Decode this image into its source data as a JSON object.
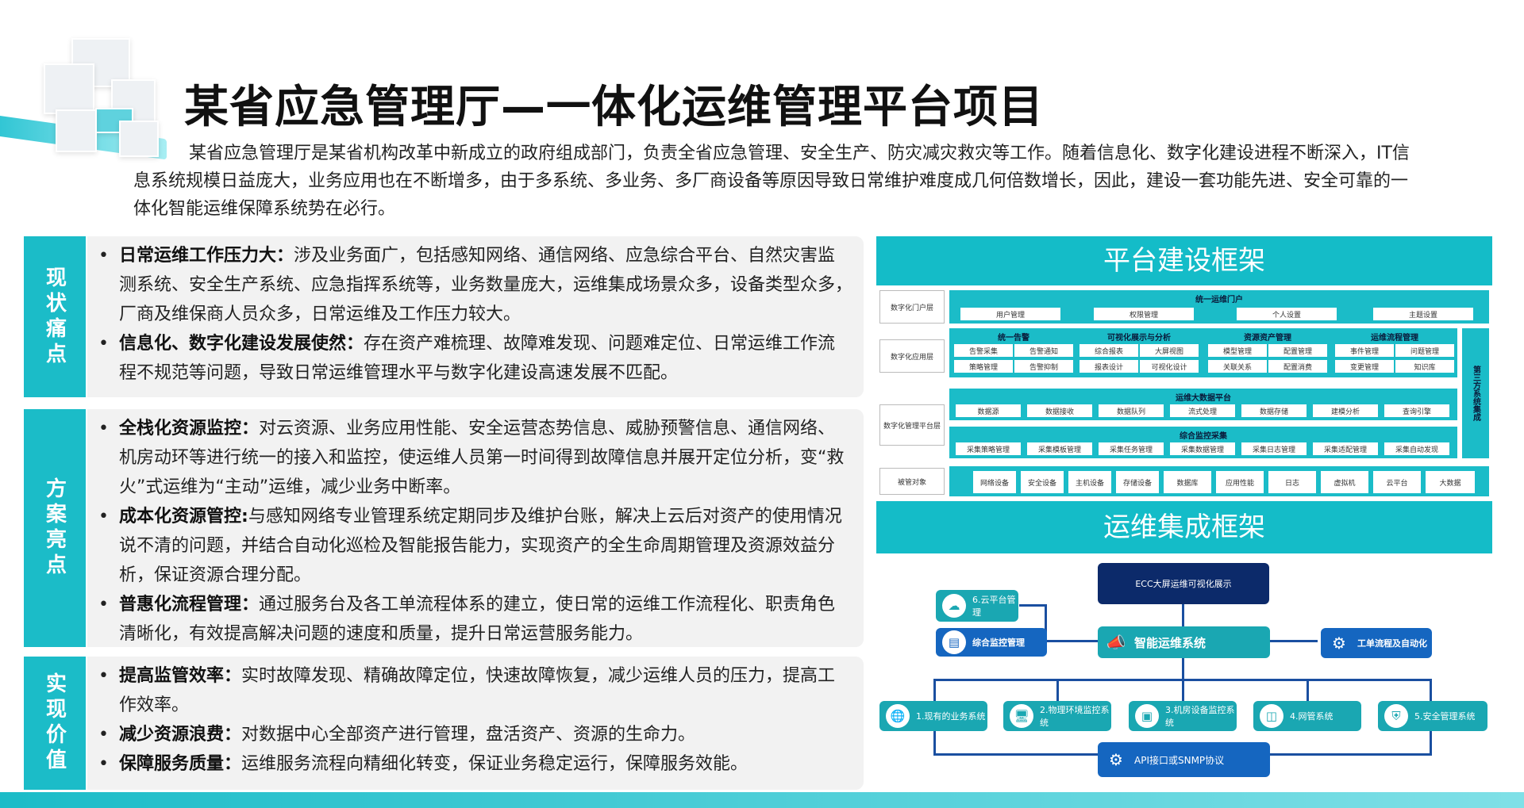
{
  "title": "某省应急管理厅—一体化运维管理平台项目",
  "intro": "某省应急管理厅是某省机构改革中新成立的政府组成部门，负责全省应急管理、安全生产、防灾减灾救灾等工作。随着信息化、数字化建设进程不断深入，IT信息系统规模日益庞大，业务应用也在不断增多，由于多系统、多业务、多厂商设备等原因导致日常维护难度成几何倍数增长，因此，建设一套功能先进、安全可靠的一体化智能运维保障系统势在必行。",
  "sections": [
    {
      "tag": "现状痛点",
      "items": [
        {
          "head": "日常运维工作压力大：",
          "text": "涉及业务面广，包括感知网络、通信网络、应急综合平台、自然灾害监测系统、安全生产系统、应急指挥系统等，业务数量庞大，运维集成场景众多，设备类型众多，厂商及维保商人员众多，日常运维及工作压力较大。"
        },
        {
          "head": "信息化、数字化建设发展使然：",
          "text": "存在资产难梳理、故障难发现、问题难定位、日常运维工作流程不规范等问题，导致日常运维管理水平与数字化建设高速发展不匹配。"
        }
      ]
    },
    {
      "tag": "方案亮点",
      "items": [
        {
          "head": "全栈化资源监控：",
          "text": "对云资源、业务应用性能、安全运营态势信息、威胁预警信息、通信网络、机房动环等进行统一的接入和监控，使运维人员第一时间得到故障信息并展开定位分析，变“救火”式运维为“主动”运维，减少业务中断率。"
        },
        {
          "head": "成本化资源管控:",
          "text": "与感知网络专业管理系统定期同步及维护台账，解决上云后对资产的使用情况说不清的问题，并结合自动化巡检及智能报告能力，实现资产的全生命周期管理及资源效益分析，保证资源合理分配。"
        },
        {
          "head": "普惠化流程管理：",
          "text": "通过服务台及各工单流程体系的建立，使日常的运维工作流程化、职责角色清晰化，有效提高解决问题的速度和质量，提升日常运营服务能力。"
        }
      ]
    },
    {
      "tag": "实现价值",
      "items": [
        {
          "head": "提高监管效率：",
          "text": "实时故障发现、精确故障定位，快速故障恢复，减少运维人员的压力，提高工作效率。"
        },
        {
          "head": "减少资源浪费：",
          "text": "对数据中心全部资产进行管理，盘活资产、资源的生命力。"
        },
        {
          "head": "保障服务质量：",
          "text": "运维服务流程向精细化转变，保证业务稳定运行，保障服务效能。"
        }
      ]
    }
  ],
  "framework": {
    "title": "平台建设框架",
    "layers": [
      "数字化门户层",
      "数字化应用层",
      "数字化管理平台层",
      "被管对象"
    ],
    "portal": {
      "title": "统一运维门户",
      "items": [
        "用户管理",
        "权限管理",
        "个人设置",
        "主题设置"
      ]
    },
    "apps": [
      {
        "title": "统一告警",
        "items": [
          "告警采集",
          "告警通知",
          "策略管理",
          "告警抑制"
        ]
      },
      {
        "title": "可视化展示与分析",
        "items": [
          "综合报表",
          "大屏视图",
          "报表设计",
          "可视化设计"
        ]
      },
      {
        "title": "资源资产管理",
        "items": [
          "模型管理",
          "配置管理",
          "关联关系",
          "配置消费"
        ]
      },
      {
        "title": "运维流程管理",
        "items": [
          "事件管理",
          "问题管理",
          "变更管理",
          "知识库"
        ]
      }
    ],
    "bigdata": {
      "title": "运维大数据平台",
      "items": [
        "数据源",
        "数据接收",
        "数据队列",
        "流式处理",
        "数据存储",
        "建模分析",
        "查询引擎"
      ]
    },
    "monitor": {
      "title": "综合监控采集",
      "items": [
        "采集策略管理",
        "采集模板管理",
        "采集任务管理",
        "采集数据管理",
        "采集日志管理",
        "采集适配管理",
        "采集自动发现"
      ]
    },
    "objects": [
      "网络设备",
      "安全设备",
      "主机设备",
      "存储设备",
      "数据库",
      "应用性能",
      "日志",
      "虚拟机",
      "云平台",
      "大数据"
    ],
    "side": "第三方系统集成"
  },
  "integration": {
    "title": "运维集成框架",
    "ecc": "ECC大屏运维可视化展示",
    "cloud": "6.云平台管理",
    "monitor": "综合监控管理",
    "core": "智能运维系统",
    "workflow": "工单流程及自动化",
    "systems": [
      "1.现有的业务系统",
      "2.物理环境监控系统",
      "3.机房设备监控系统",
      "4.网管系统",
      "5.安全管理系统"
    ],
    "api": "API接口或SNMP协议",
    "colors": {
      "navy": "#0c2a6a",
      "blue": "#1566c0",
      "teal": "#1aa7b2",
      "cyan": "#14bcc8"
    }
  }
}
